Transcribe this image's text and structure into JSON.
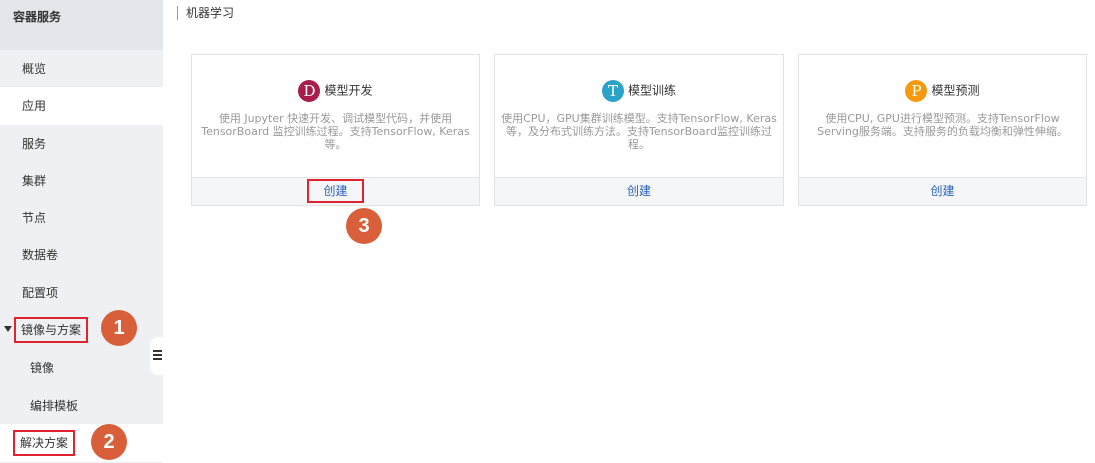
{
  "sidebar": {
    "title": "容器服务",
    "items": [
      {
        "label": "概览"
      },
      {
        "label": "应用"
      },
      {
        "label": "服务"
      },
      {
        "label": "集群"
      },
      {
        "label": "节点"
      },
      {
        "label": "数据卷"
      },
      {
        "label": "配置项"
      },
      {
        "label": "镜像与方案"
      },
      {
        "label": "镜像"
      },
      {
        "label": "编排模板"
      },
      {
        "label": "解决方案"
      }
    ]
  },
  "callouts": [
    "1",
    "2",
    "3"
  ],
  "main": {
    "title": "机器学习",
    "cards": [
      {
        "badge": "D",
        "badge_color": "#a81d4c",
        "name": "模型开发",
        "description": "使用 Jupyter 快速开发、调试模型代码，并使用 TensorBoard 监控训练过程。支持TensorFlow, Keras 等。",
        "action": "创建"
      },
      {
        "badge": "T",
        "badge_color": "#2aa3c9",
        "name": "模型训练",
        "description": "使用CPU，GPU集群训练模型。支持TensorFlow, Keras等，及分布式训练方法。支持TensorBoard监控训练过程。",
        "action": "创建"
      },
      {
        "badge": "P",
        "badge_color": "#f59a0f",
        "name": "模型预测",
        "description": "使用CPU, GPU进行模型预测。支持TensorFlow Serving服务端。支持服务的负载均衡和弹性伸缩。",
        "action": "创建"
      }
    ]
  }
}
